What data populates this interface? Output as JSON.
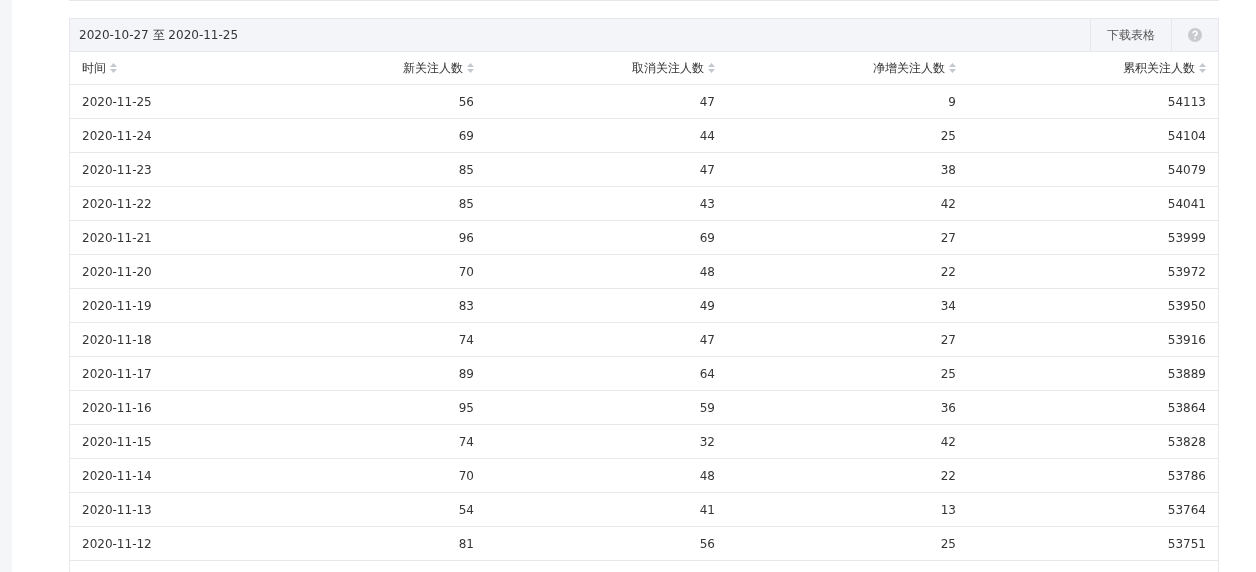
{
  "table": {
    "date_range": "2020-10-27 至 2020-11-25",
    "download_button": "下载表格",
    "columns": [
      "时间",
      "新关注人数",
      "取消关注人数",
      "净增关注人数",
      "累积关注人数"
    ],
    "rows": [
      [
        "2020-11-25",
        "56",
        "47",
        "9",
        "54113"
      ],
      [
        "2020-11-24",
        "69",
        "44",
        "25",
        "54104"
      ],
      [
        "2020-11-23",
        "85",
        "47",
        "38",
        "54079"
      ],
      [
        "2020-11-22",
        "85",
        "43",
        "42",
        "54041"
      ],
      [
        "2020-11-21",
        "96",
        "69",
        "27",
        "53999"
      ],
      [
        "2020-11-20",
        "70",
        "48",
        "22",
        "53972"
      ],
      [
        "2020-11-19",
        "83",
        "49",
        "34",
        "53950"
      ],
      [
        "2020-11-18",
        "74",
        "47",
        "27",
        "53916"
      ],
      [
        "2020-11-17",
        "89",
        "64",
        "25",
        "53889"
      ],
      [
        "2020-11-16",
        "95",
        "59",
        "36",
        "53864"
      ],
      [
        "2020-11-15",
        "74",
        "32",
        "42",
        "53828"
      ],
      [
        "2020-11-14",
        "70",
        "48",
        "22",
        "53786"
      ],
      [
        "2020-11-13",
        "54",
        "41",
        "13",
        "53764"
      ],
      [
        "2020-11-12",
        "81",
        "56",
        "25",
        "53751"
      ]
    ]
  }
}
